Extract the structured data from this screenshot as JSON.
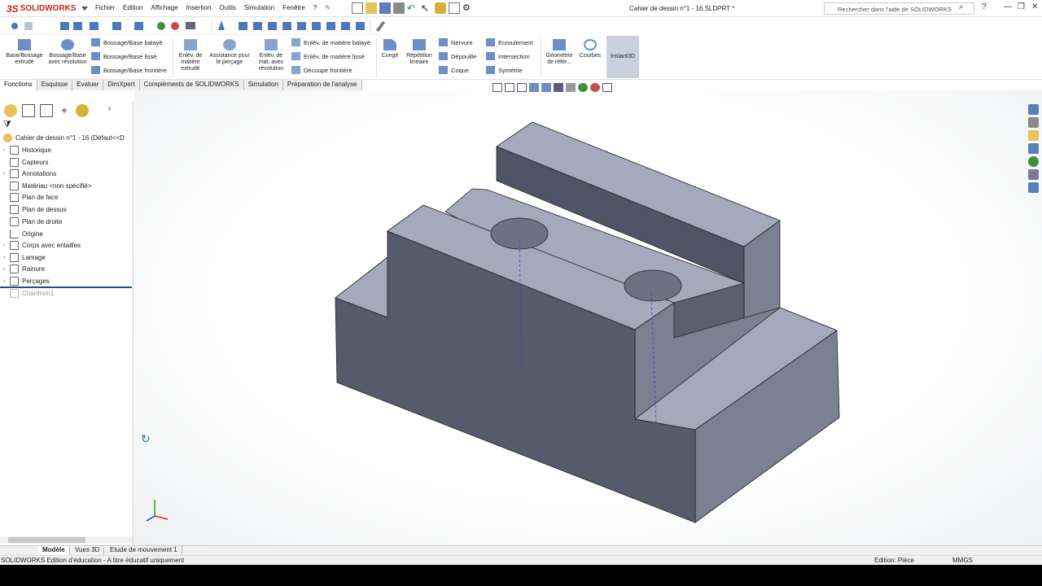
{
  "app": {
    "brand": "SOLIDWORKS",
    "title": "Cahier de dessin n°1 - 16.SLDPRT *",
    "search_placeholder": "Rechercher dans l'aide de SOLIDWORKS"
  },
  "menu": [
    "Fichier",
    "Edition",
    "Affichage",
    "Insertion",
    "Outils",
    "Simulation",
    "Fenêtre",
    "?"
  ],
  "ribbon": {
    "extrude": "Base/Bossage extrudé",
    "revolve": "Bossage/Base avec révolution",
    "swept": "Bossage/Base balayé",
    "lofted": "Bossage/Base lissé",
    "boundary": "Bossage/Base frontière",
    "cut_extrude": "Enlév. de matière extrudé",
    "hole": "Assistance pour le perçage",
    "cut_revolve": "Enlév. de mat. avec révolution",
    "cut_swept": "Enlév. de matière balayé",
    "cut_lofted": "Enlév. de matière lissé",
    "cut_boundary": "Découpe frontière",
    "fillet": "Congé",
    "pattern": "Répétition linéaire",
    "rib": "Nervure",
    "draft": "Dépouille",
    "shell": "Coque",
    "wrap": "Enroulement",
    "intersect": "Intersection",
    "mirror": "Symétrie",
    "refgeom": "Géométrie de référ...",
    "curves": "Courbes",
    "instant3d": "Instant3D"
  },
  "tabs": [
    "Fonctions",
    "Esquisse",
    "Evaluer",
    "DimXpert",
    "Compléments de SOLIDWORKS",
    "Simulation",
    "Préparation de l'analyse"
  ],
  "tree": {
    "root": "Cahier de dessin n°1 - 16  (Défaut<<D",
    "items": [
      "Historique",
      "Capteurs",
      "Annotations",
      "Matériau <non spécifié>",
      "Plan de face",
      "Plan de dessus",
      "Plan de droite",
      "Origine",
      "Corps avec entailles",
      "Lamage",
      "Rainure",
      "Perçages",
      "Chanfrein1"
    ]
  },
  "bottom_tabs": [
    "Modèle",
    "Vues 3D",
    "Etude de mouvement 1"
  ],
  "status": {
    "left": "SOLIDWORKS Edition d'éducation - A titre éducatif uniquement",
    "mode": "Edition: Pièce",
    "units": "MMGS"
  },
  "colors": {
    "accent": "#d21f1f",
    "part_top": "#a6aabd",
    "part_front": "#565a6a",
    "part_side": "#7b7f92"
  }
}
